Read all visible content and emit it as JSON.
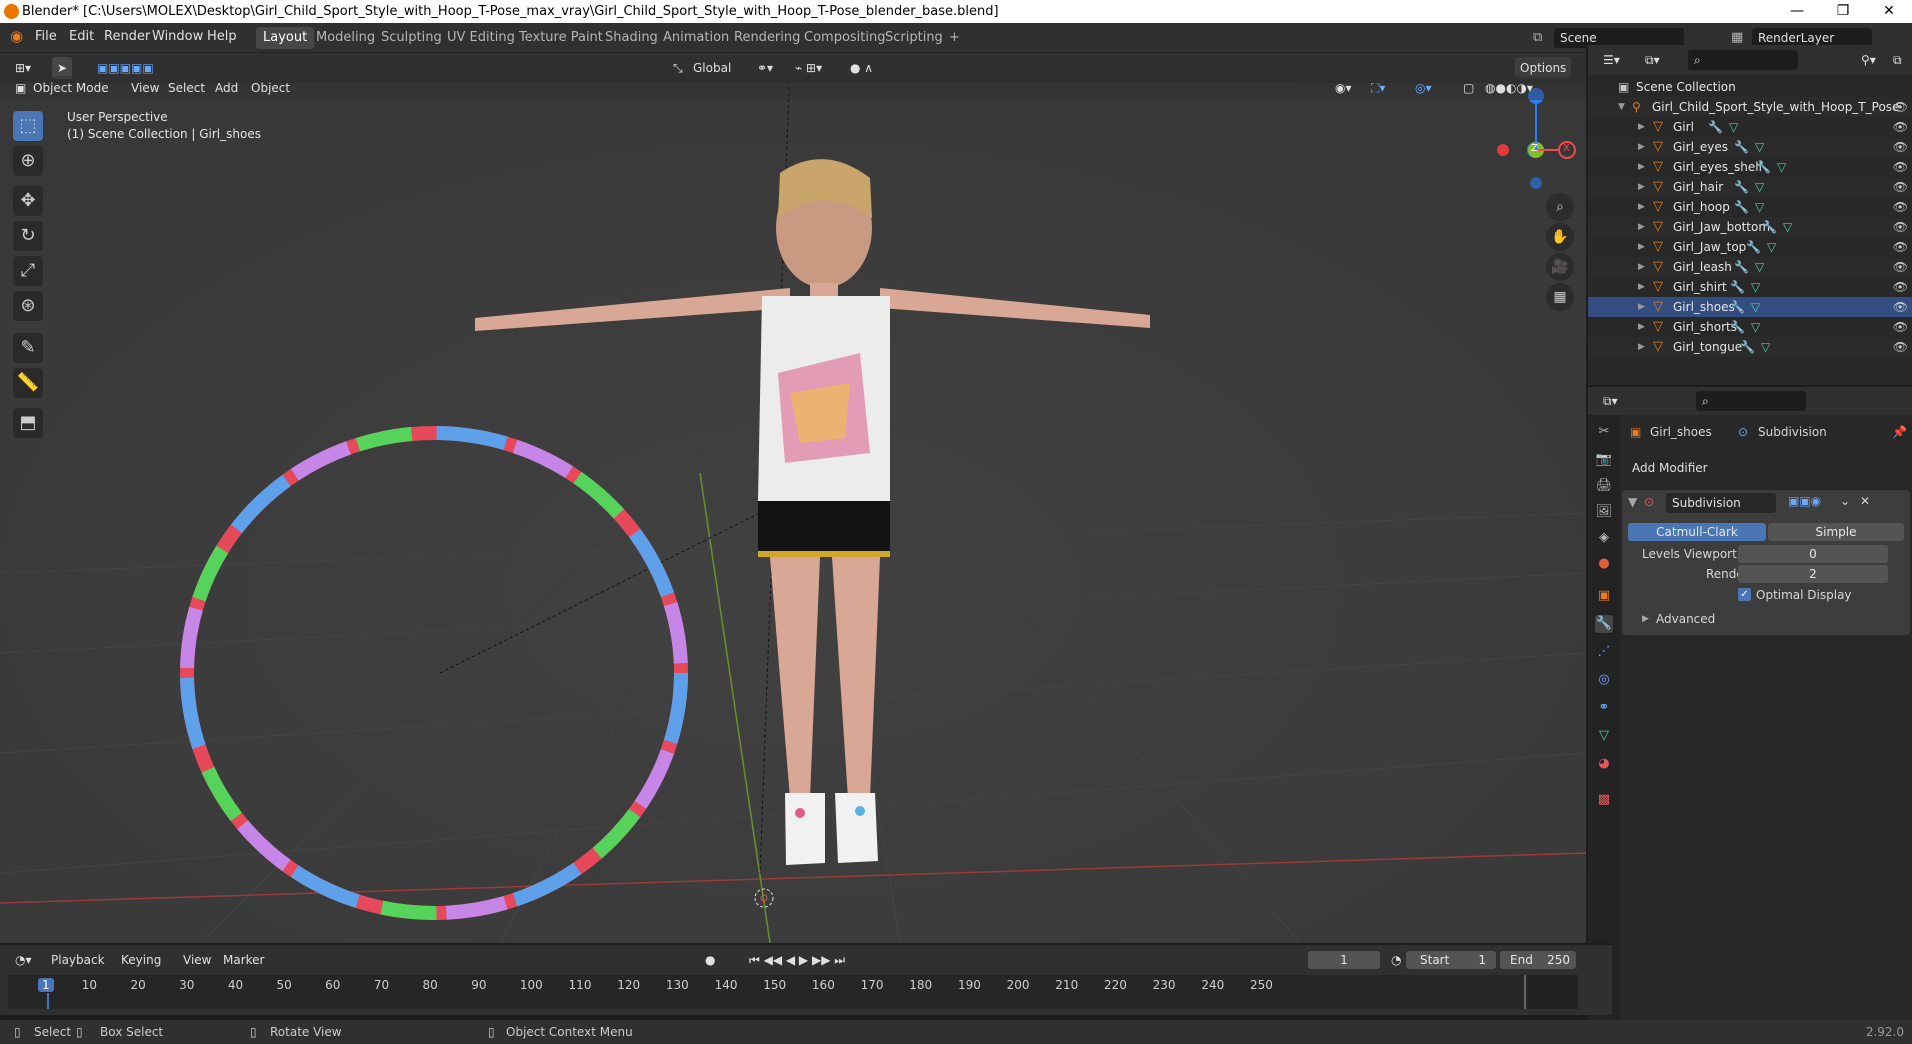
{
  "window": {
    "title": "Blender* [C:\\Users\\MOLEX\\Desktop\\Girl_Child_Sport_Style_with_Hoop_T-Pose_max_vray\\Girl_Child_Sport_Style_with_Hoop_T-Pose_blender_base.blend]"
  },
  "menu": [
    "File",
    "Edit",
    "Render",
    "Window",
    "Help"
  ],
  "workspaces": [
    "Layout",
    "Modeling",
    "Sculpting",
    "UV Editing",
    "Texture Paint",
    "Shading",
    "Animation",
    "Rendering",
    "Compositing",
    "Scripting"
  ],
  "active_workspace": "Layout",
  "scene": {
    "label": "Scene",
    "render_layer": "RenderLayer"
  },
  "viewport_header": {
    "orientation": "Global",
    "options": "Options",
    "mode": "Object Mode",
    "menus": [
      "View",
      "Select",
      "Add",
      "Object"
    ]
  },
  "viewport": {
    "perspective": "User Perspective",
    "collection": "(1) Scene Collection | Girl_shoes"
  },
  "gizmo": {
    "z": "Z",
    "x": "X"
  },
  "outliner": {
    "root": "Scene Collection",
    "collection": "Girl_Child_Sport_Style_with_Hoop_T_Pose",
    "objects": [
      "Girl",
      "Girl_eyes",
      "Girl_eyes_shell",
      "Girl_hair",
      "Girl_hoop",
      "Girl_Jaw_bottom",
      "Girl_Jaw_top",
      "Girl_leash",
      "Girl_shirt",
      "Girl_shoes",
      "Girl_shorts",
      "Girl_tongue"
    ]
  },
  "properties": {
    "object": "Girl_shoes",
    "modifier_crumb": "Subdivision",
    "add_modifier": "Add Modifier",
    "modifier_name": "Subdivision",
    "tabs": [
      "Catmull-Clark",
      "Simple"
    ],
    "levels_viewport_label": "Levels Viewport",
    "levels_viewport": "0",
    "render_label": "Render",
    "render": "2",
    "optimal_display": "Optimal Display",
    "advanced": "Advanced"
  },
  "timeline": {
    "menus": [
      "Playback",
      "Keying",
      "View",
      "Marker"
    ],
    "current_frame": "1",
    "start_label": "Start",
    "start": "1",
    "end_label": "End",
    "end": "250",
    "ticks": [
      "1",
      "10",
      "20",
      "30",
      "40",
      "50",
      "60",
      "70",
      "80",
      "90",
      "100",
      "110",
      "120",
      "130",
      "140",
      "150",
      "160",
      "170",
      "180",
      "190",
      "200",
      "210",
      "220",
      "230",
      "240",
      "250"
    ]
  },
  "status": {
    "select": "Select",
    "box_select": "Box Select",
    "rotate": "Rotate View",
    "context": "Object Context Menu",
    "version": "2.92.0"
  },
  "colors": {
    "accent": "#4a76b5",
    "orange": "#e87d1e",
    "viewport_bg": "#3b3b3b",
    "panel": "#282828"
  }
}
